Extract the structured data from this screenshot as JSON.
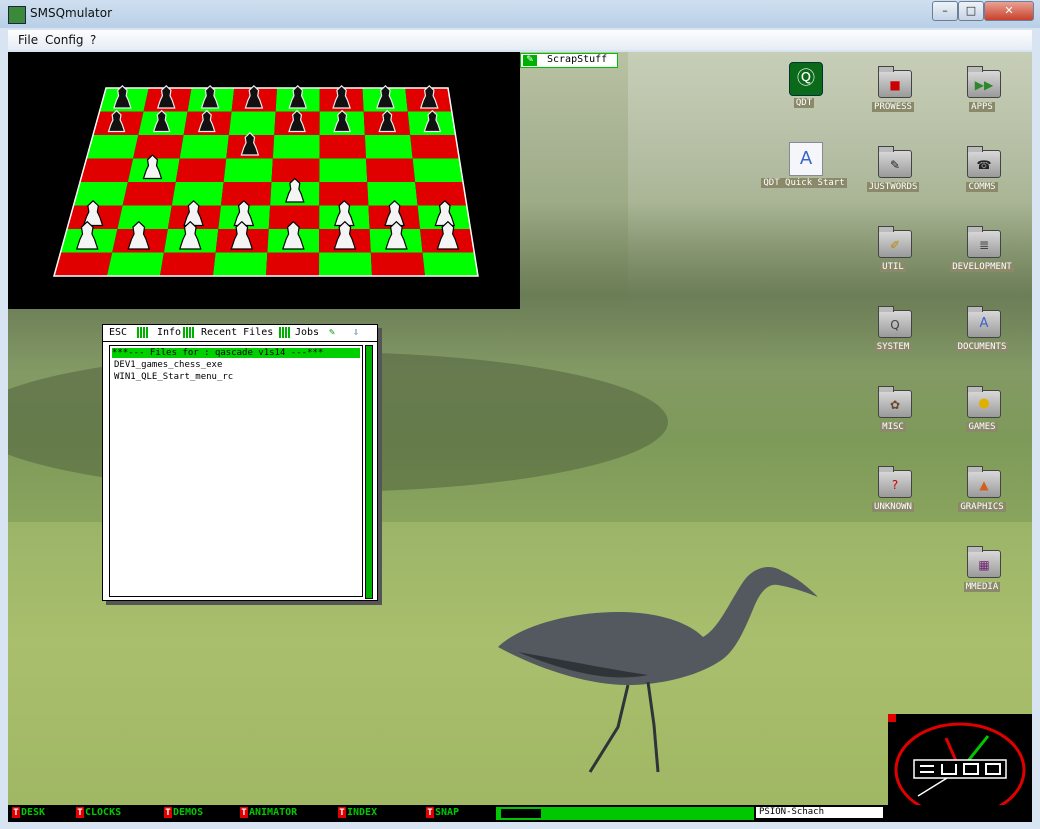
{
  "window": {
    "title": "SMSQmulator",
    "buttons": {
      "minimize": "–",
      "maximize": "□",
      "close": "✕"
    }
  },
  "menu": [
    "File",
    "Config",
    "?"
  ],
  "scrap": {
    "label": "ScrapStuff"
  },
  "filewin": {
    "tabs": [
      "ESC",
      "Info",
      "Recent Files",
      "Jobs"
    ],
    "header": "***--- Files for : qascade v1s14 ---***",
    "files": [
      "DEV1_games_chess_exe",
      "WIN1_QLE_Start_menu_rc"
    ]
  },
  "icons": [
    {
      "label": "QDT",
      "glyph": "Q-logo-icon"
    },
    {
      "label": "PROWESS",
      "glyph": "prowess-folder-icon"
    },
    {
      "label": "APPS",
      "glyph": "apps-folder-icon"
    },
    {
      "label": "QDT Quick Start",
      "glyph": "document-icon"
    },
    {
      "label": "JUSTWORDS",
      "glyph": "justwords-folder-icon"
    },
    {
      "label": "COMMS",
      "glyph": "comms-folder-icon"
    },
    {
      "label": "UTIL",
      "glyph": "util-folder-icon"
    },
    {
      "label": "DEVELOPMENT",
      "glyph": "development-folder-icon"
    },
    {
      "label": "SYSTEM",
      "glyph": "system-folder-icon"
    },
    {
      "label": "DOCUMENTS",
      "glyph": "documents-folder-icon"
    },
    {
      "label": "MISC",
      "glyph": "misc-folder-icon"
    },
    {
      "label": "GAMES",
      "glyph": "games-folder-icon"
    },
    {
      "label": "UNKNOWN",
      "glyph": "unknown-folder-icon"
    },
    {
      "label": "GRAPHICS",
      "glyph": "graphics-folder-icon"
    },
    {
      "label": "MMEDIA",
      "glyph": "mmedia-folder-icon"
    }
  ],
  "taskbar": {
    "items": [
      "DESK",
      "CLOCKS",
      "DEMOS",
      "ANIMATOR",
      "INDEX",
      "SNAP"
    ],
    "active_task": "PSION-Schach"
  },
  "colors": {
    "qdt_green": "#00c000",
    "board_green": "#00ff00",
    "board_red": "#e00000",
    "mark_red": "#e00000"
  }
}
